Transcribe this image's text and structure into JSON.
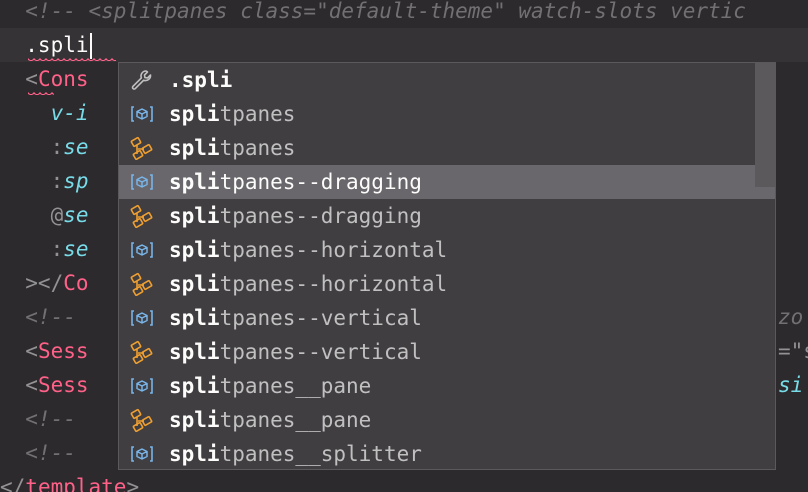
{
  "editor": {
    "lines": [
      {
        "segments": [
          {
            "cls": "cm",
            "text": "  <!-- <splitpanes class=\"default-theme\" watch-slots vertic"
          }
        ]
      },
      {
        "segments": [
          {
            "cls": "txt",
            "text": "  .spli"
          }
        ],
        "cursor": true,
        "current": true
      },
      {
        "segments": [
          {
            "cls": "punc",
            "text": "  <"
          },
          {
            "cls": "tag",
            "text": "Cons"
          }
        ]
      },
      {
        "segments": [
          {
            "cls": "attr",
            "text": "    v-i"
          }
        ]
      },
      {
        "segments": [
          {
            "cls": "punc",
            "text": "    :"
          },
          {
            "cls": "attr",
            "text": "se"
          }
        ]
      },
      {
        "segments": [
          {
            "cls": "punc",
            "text": "    :"
          },
          {
            "cls": "attr",
            "text": "sp"
          }
        ]
      },
      {
        "segments": [
          {
            "cls": "punc",
            "text": "    @"
          },
          {
            "cls": "attr",
            "text": "se"
          }
        ]
      },
      {
        "segments": [
          {
            "cls": "punc",
            "text": "    :"
          },
          {
            "cls": "attr",
            "text": "se"
          }
        ]
      },
      {
        "segments": [
          {
            "cls": "punc",
            "text": "  ></"
          },
          {
            "cls": "tag",
            "text": "Co"
          }
        ]
      },
      {
        "segments": [
          {
            "cls": "cm",
            "text": "  <!--"
          }
        ]
      },
      {
        "segments": [
          {
            "cls": "punc",
            "text": "  <"
          },
          {
            "cls": "tag",
            "text": "Sess"
          }
        ]
      },
      {
        "segments": [
          {
            "cls": "punc",
            "text": "  <"
          },
          {
            "cls": "tag",
            "text": "Sess"
          }
        ]
      },
      {
        "segments": [
          {
            "cls": "cm",
            "text": "  <!--"
          }
        ]
      },
      {
        "segments": [
          {
            "cls": "cm",
            "text": "  <!--"
          }
        ]
      },
      {
        "segments": [
          {
            "cls": "punc",
            "text": "</"
          },
          {
            "cls": "tag",
            "text": "template"
          },
          {
            "cls": "punc",
            "text": ">"
          }
        ]
      }
    ],
    "right_fragments": [
      {
        "line": 9,
        "cls": "cm",
        "text": "zo"
      },
      {
        "line": 10,
        "cls": "punc",
        "text": "=\"s"
      },
      {
        "line": 11,
        "cls": "attr",
        "text": "si"
      }
    ]
  },
  "suggest": {
    "match": "spli",
    "items": [
      {
        "kind": "wrench-icon",
        "prefix": ".",
        "match": "spli",
        "rest": ""
      },
      {
        "kind": "class-icon",
        "prefix": "",
        "match": "spli",
        "rest": "tpanes"
      },
      {
        "kind": "symbol-tree-icon",
        "prefix": "",
        "match": "spli",
        "rest": "tpanes"
      },
      {
        "kind": "class-icon",
        "prefix": "",
        "match": "spli",
        "rest": "tpanes--dragging",
        "selected": true
      },
      {
        "kind": "symbol-tree-icon",
        "prefix": "",
        "match": "spli",
        "rest": "tpanes--dragging"
      },
      {
        "kind": "class-icon",
        "prefix": "",
        "match": "spli",
        "rest": "tpanes--horizontal"
      },
      {
        "kind": "symbol-tree-icon",
        "prefix": "",
        "match": "spli",
        "rest": "tpanes--horizontal"
      },
      {
        "kind": "class-icon",
        "prefix": "",
        "match": "spli",
        "rest": "tpanes--vertical"
      },
      {
        "kind": "symbol-tree-icon",
        "prefix": "",
        "match": "spli",
        "rest": "tpanes--vertical"
      },
      {
        "kind": "class-icon",
        "prefix": "",
        "match": "spli",
        "rest": "tpanes__pane"
      },
      {
        "kind": "symbol-tree-icon",
        "prefix": "",
        "match": "spli",
        "rest": "tpanes__pane"
      },
      {
        "kind": "class-icon",
        "prefix": "",
        "match": "spli",
        "rest": "tpanes__splitter"
      }
    ]
  },
  "colors": {
    "background": "#2d2a2e",
    "widget_bg": "#403e41",
    "selected_bg": "#69676c",
    "class_icon": "#78b4e8",
    "tree_icon": "#f0a030",
    "wrench_icon": "#c1c0c0",
    "error_squiggle": "#ff6188"
  }
}
